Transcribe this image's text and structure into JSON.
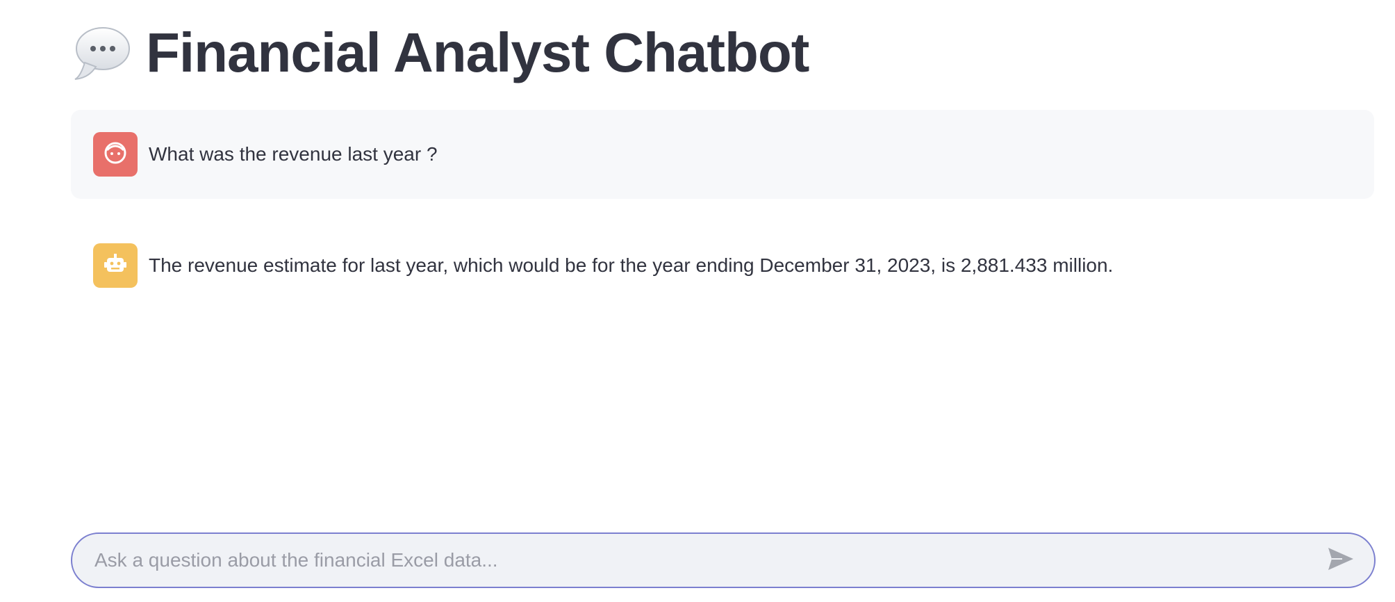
{
  "app": {
    "title": "Financial Analyst Chatbot",
    "title_icon": "speech-bubble-icon"
  },
  "messages": [
    {
      "role": "user",
      "avatar_icon": "user-face-icon",
      "avatar_color": "#e8706a",
      "text": "What was the revenue last year ?"
    },
    {
      "role": "assistant",
      "avatar_icon": "robot-icon",
      "avatar_color": "#f4c15d",
      "text": "The revenue estimate for last year, which would be for the year ending December 31, 2023, is 2,881.433 million."
    }
  ],
  "chat_input": {
    "placeholder": "Ask a question about the financial Excel data...",
    "value": "",
    "send_icon": "send-icon"
  },
  "colors": {
    "accent": "#7b7fcf",
    "user_bubble_bg": "#f7f8fa",
    "input_bg": "#f0f2f6",
    "text": "#31333f"
  }
}
